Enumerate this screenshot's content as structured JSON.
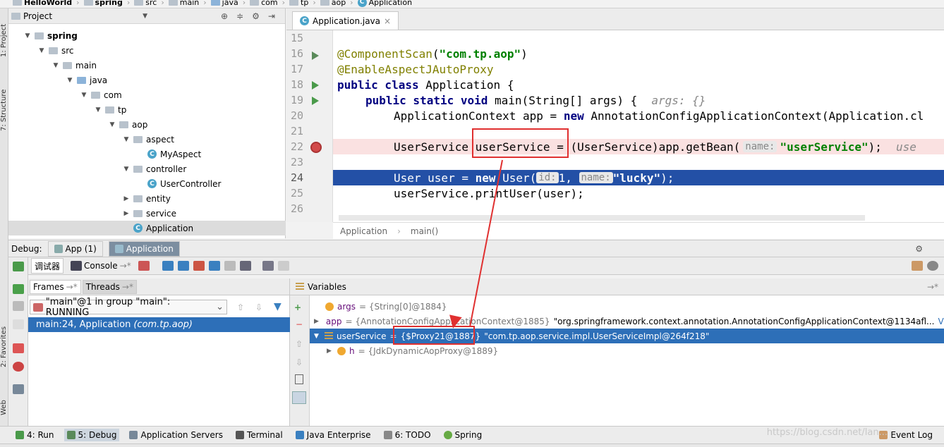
{
  "breadcrumb": [
    "HelloWorld",
    "spring",
    "src",
    "main",
    "java",
    "com",
    "tp",
    "aop",
    "Application"
  ],
  "sidebar_left": {
    "project_label": "1: Project",
    "structure_label": "7: Structure",
    "favorites_label": "2: Favorites",
    "web_label": "Web"
  },
  "project_panel": {
    "title": "Project",
    "tree": [
      {
        "label": "spring",
        "depth": 1,
        "kind": "folder",
        "open": true,
        "bold": true
      },
      {
        "label": "src",
        "depth": 2,
        "kind": "folder",
        "open": true
      },
      {
        "label": "main",
        "depth": 3,
        "kind": "folder",
        "open": true
      },
      {
        "label": "java",
        "depth": 4,
        "kind": "folder-blue",
        "open": true
      },
      {
        "label": "com",
        "depth": 5,
        "kind": "folder",
        "open": true
      },
      {
        "label": "tp",
        "depth": 6,
        "kind": "folder",
        "open": true
      },
      {
        "label": "aop",
        "depth": 7,
        "kind": "folder",
        "open": true
      },
      {
        "label": "aspect",
        "depth": 8,
        "kind": "folder",
        "open": true
      },
      {
        "label": "MyAspect",
        "depth": 9,
        "kind": "class"
      },
      {
        "label": "controller",
        "depth": 8,
        "kind": "folder",
        "open": true
      },
      {
        "label": "UserController",
        "depth": 9,
        "kind": "class"
      },
      {
        "label": "entity",
        "depth": 8,
        "kind": "folder",
        "open": false
      },
      {
        "label": "service",
        "depth": 8,
        "kind": "folder",
        "open": false
      },
      {
        "label": "Application",
        "depth": 8,
        "kind": "class",
        "selected": true
      }
    ]
  },
  "editor": {
    "tab_label": "Application.java",
    "close_glyph": "×",
    "line_numbers": [
      "15",
      "16",
      "17",
      "18",
      "19",
      "20",
      "21",
      "22",
      "23",
      "24",
      "25",
      "26"
    ],
    "code_lines": {
      "l16": {
        "an": "@ComponentScan",
        "p1": "(",
        "st": "\"com.tp.aop\"",
        "p2": ")"
      },
      "l17": {
        "an": "@EnableAspectJAutoProxy"
      },
      "l18": {
        "kw": "public class",
        "rest": " Application {"
      },
      "l19": {
        "kw": "public static void",
        "rest": " main(String[] args) {",
        "hint": "args: {}"
      },
      "l20": {
        "rest": "ApplicationContext app = ",
        "kw": "new",
        "rest2": " AnnotationConfigApplicationContext(Application.cl"
      },
      "l22": {
        "rest": "UserService userService = (UserService)app.getBean(",
        "pill": "name:",
        "st": "\"userService\"",
        "rest2": ");",
        "hint": "use"
      },
      "l24": {
        "rest": "User user = ",
        "kw": "new",
        "rest2": " User(",
        "pill1": "id:",
        "num": "1, ",
        "pill2": "name:",
        "st": "\"lucky\"",
        "rest3": ");"
      },
      "l25": {
        "rest": "userService.printUser(user);"
      }
    },
    "breadcrumb": [
      "Application",
      "main()"
    ]
  },
  "debug": {
    "label": "Debug:",
    "tabs": [
      "App (1)",
      "Application"
    ],
    "toolbar": {
      "debugger_tab": "调试器",
      "console_tab": "Console"
    },
    "frames": {
      "tab_frames": "Frames",
      "tab_threads": "Threads",
      "thread_text": "\"main\"@1 in group \"main\": RUNNING",
      "frame_main": "main:24, Application",
      "frame_pkg": "(com.tp.aop)"
    },
    "variables": {
      "title": "Variables",
      "rows": [
        {
          "name": "args",
          "value_gray": "= {String[0]@1884}",
          "value": ""
        },
        {
          "name": "app",
          "value_gray": "= {AnnotationConfigApplicationContext@1885}",
          "value": "\"org.springframework.context.annotation.AnnotationConfigApplicationContext@1134afl...",
          "link": "View"
        },
        {
          "name": "userService",
          "value_gray": "=",
          "value_box": "{$Proxy21@1887}",
          "value": "\"com.tp.aop.service.impl.UserServiceImpl@264f218\"",
          "selected": true
        },
        {
          "name": "h",
          "value_gray": "= {JdkDynamicAopProxy@1889}",
          "value": ""
        }
      ]
    }
  },
  "statusbar": {
    "items": [
      "4: Run",
      "5: Debug",
      "Application Servers",
      "Terminal",
      "Java Enterprise",
      "6: TODO",
      "Spring"
    ],
    "right": "Event Log",
    "watermark": "https://blog.csdn.net/lan..."
  },
  "colors": {
    "accent": "#2d6fb8",
    "annotation_red": "#e03030",
    "selection": "#2350a6"
  }
}
